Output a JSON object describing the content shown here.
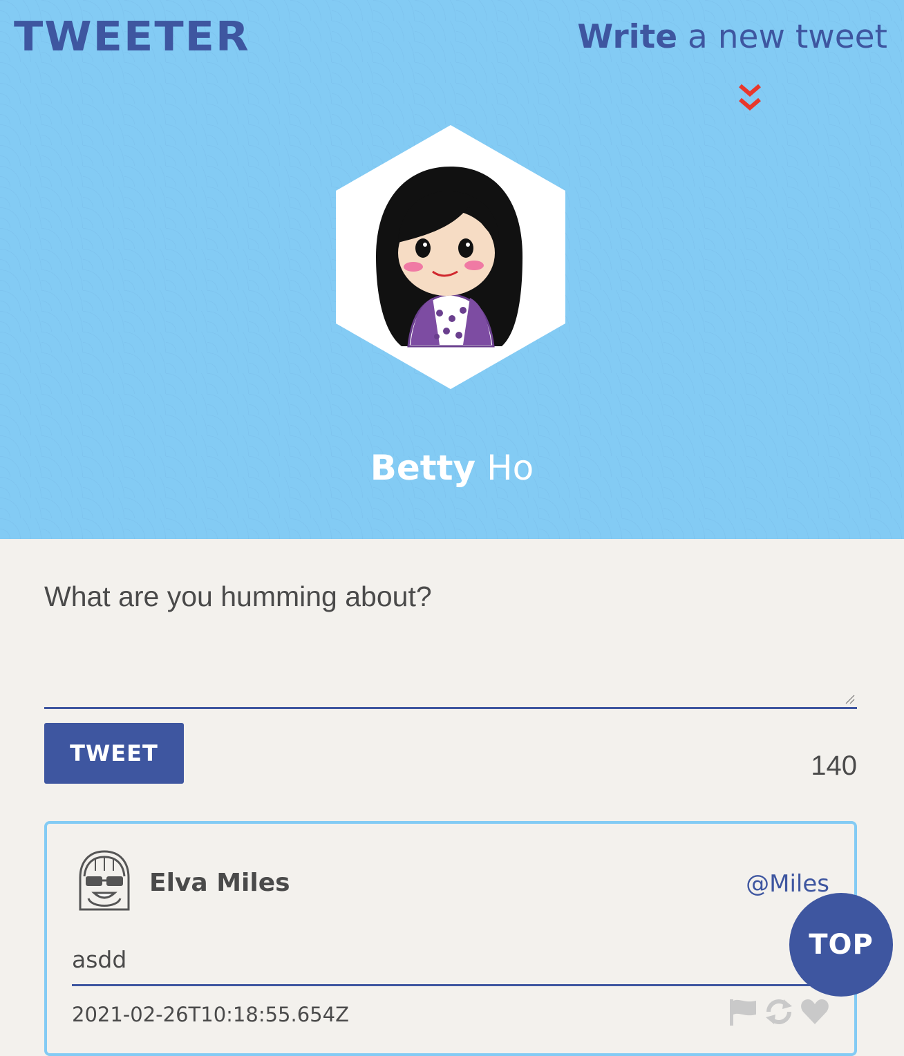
{
  "header": {
    "logo": "TWEETER",
    "write_link": {
      "bold": "Write",
      "rest": "a new tweet"
    },
    "toggle_icon": "chevron-double-down-icon"
  },
  "profile": {
    "avatar_icon": "girl-avatar",
    "first_name": "Betty",
    "last_name": "Ho"
  },
  "composer": {
    "placeholder": "What are you humming about?",
    "value": "",
    "submit_label": "TWEET",
    "char_count": "140"
  },
  "tweets": [
    {
      "avatar_icon": "sunglasses-avatar",
      "author": "Elva Miles",
      "handle": "@Miles",
      "content": "asdd",
      "created_at": "2021-02-26T10:18:55.654Z",
      "actions": [
        "flag-icon",
        "retweet-icon",
        "heart-icon"
      ]
    }
  ],
  "scroll_top_label": "TOP",
  "colors": {
    "hero_bg": "#83cbf4",
    "brand_blue": "#3e56a0",
    "accent_red": "#e8372c",
    "page_bg": "#f3f1ed",
    "text": "#4a4a4a"
  }
}
